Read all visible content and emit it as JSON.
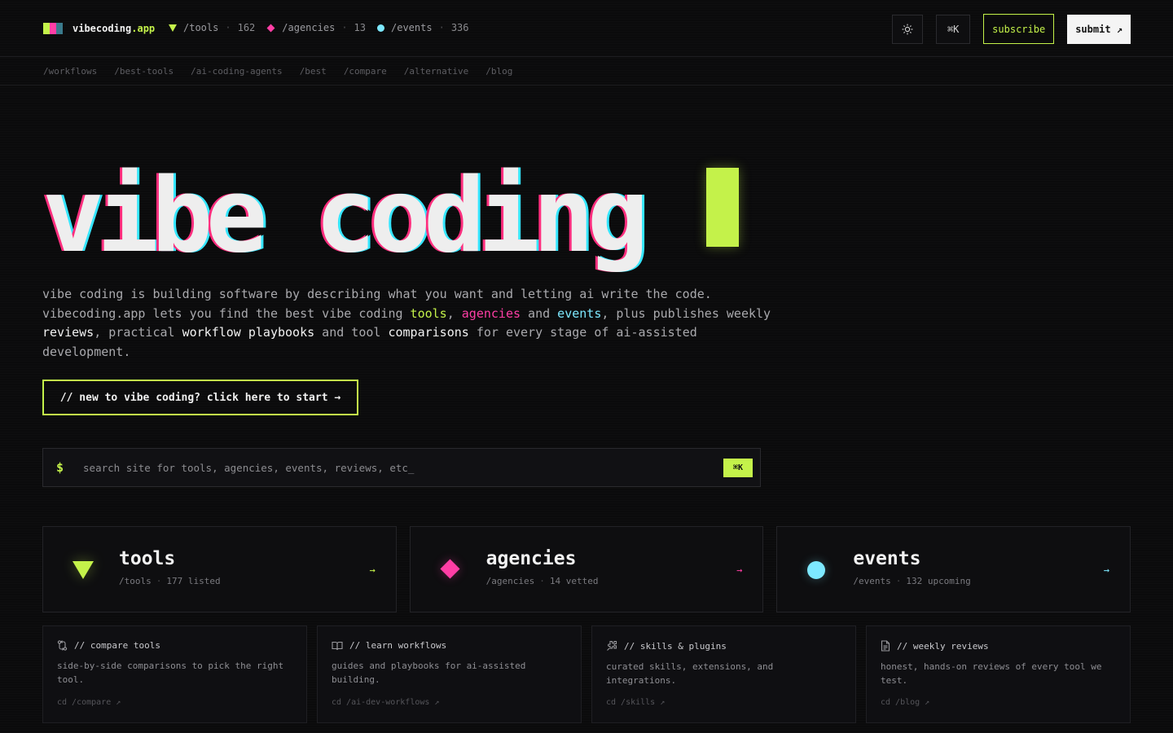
{
  "brand": {
    "name": "vibecoding",
    "tld": ".app",
    "logo_colors": [
      "#c4f24a",
      "#ff3ea5",
      "#3a7a8c"
    ]
  },
  "stats": [
    {
      "marker": "triangle",
      "color": "#c4f24a",
      "path": "/tools",
      "count": "162"
    },
    {
      "marker": "diamond",
      "color": "#ff3ea5",
      "path": "/agencies",
      "count": "13"
    },
    {
      "marker": "dot",
      "color": "#7de8ff",
      "path": "/events",
      "count": "336"
    }
  ],
  "actions": {
    "theme_icon": "sun-icon",
    "kbd_label": "⌘K",
    "subscribe_label": "subscribe",
    "submit_label": "submit ↗"
  },
  "nav": [
    "/workflows",
    "/best-tools",
    "/ai-coding-agents",
    "/best",
    "/compare",
    "/alternative",
    "/blog"
  ],
  "hero": {
    "title": "vibe coding",
    "intro_1": "vibe coding is building software by describing what you want and letting ai write the code. vibecoding.app lets you find the best vibe coding ",
    "intro_tools": "tools",
    "intro_comma": ", ",
    "intro_agencies": "agencies",
    "intro_and": " and ",
    "intro_events": "events",
    "intro_2": ", plus publishes weekly ",
    "intro_reviews": "reviews",
    "intro_3": ", practical ",
    "intro_workflow": "workflow playbooks",
    "intro_4": " and tool ",
    "intro_comparisons": "comparisons",
    "intro_5": " for every stage of ai-assisted development.",
    "start_button": "// new to vibe coding? click here to start →"
  },
  "search": {
    "prompt": "$",
    "placeholder": "search site for tools, agencies, events, reviews, etc_",
    "kbd": "⌘K"
  },
  "directories": [
    {
      "title": "tools",
      "path": "/tools",
      "count": "177 listed",
      "color": "#c4f24a",
      "arrow": "→"
    },
    {
      "title": "agencies",
      "path": "/agencies",
      "count": "14 vetted",
      "color": "#ff3ea5",
      "arrow": "→"
    },
    {
      "title": "events",
      "path": "/events",
      "count": "132 upcoming",
      "color": "#7de8ff",
      "arrow": "→"
    }
  ],
  "features": [
    {
      "icon": "compare-icon",
      "title": "// compare tools",
      "desc": "side-by-side comparisons to pick the right tool.",
      "link": "cd /compare ↗"
    },
    {
      "icon": "book-icon",
      "title": "// learn workflows",
      "desc": "guides and playbooks for ai-assisted building.",
      "link": "cd /ai-dev-workflows ↗"
    },
    {
      "icon": "puzzle-icon",
      "title": "// skills & plugins",
      "desc": "curated skills, extensions, and integrations.",
      "link": "cd /skills ↗"
    },
    {
      "icon": "document-icon",
      "title": "// weekly reviews",
      "desc": "honest, hands-on reviews of every tool we test.",
      "link": "cd /blog ↗"
    }
  ]
}
